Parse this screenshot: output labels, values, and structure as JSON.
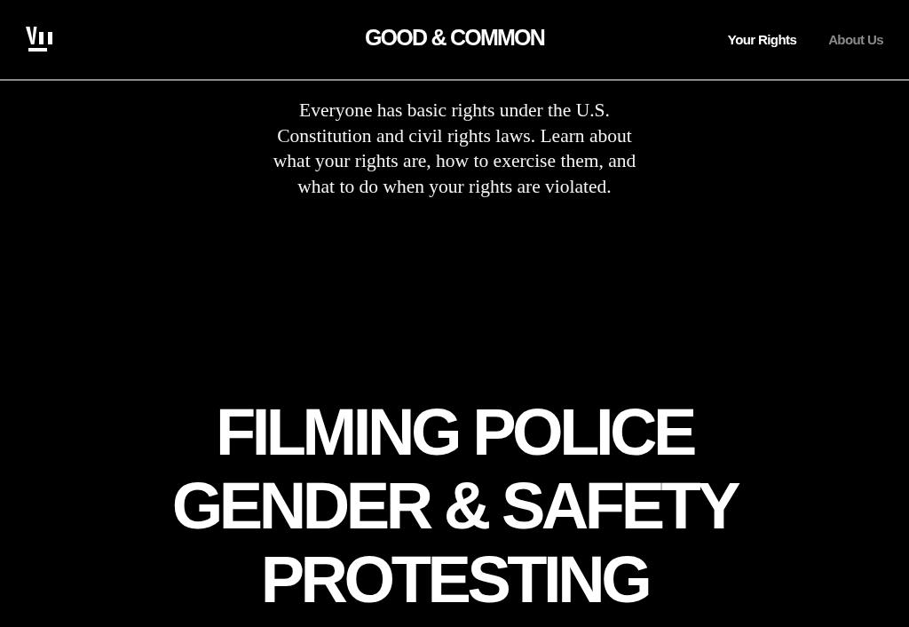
{
  "header": {
    "site_title": "GOOD & COMMON",
    "nav": [
      {
        "label": "Your Rights",
        "selected": true
      },
      {
        "label": "About Us",
        "selected": false
      }
    ]
  },
  "intro": "Everyone has basic rights under the U.S. Constitution and civil rights laws. Learn about what your rights are, how to exercise them, and what to do when your rights are violated.",
  "topics": [
    "FILMING POLICE",
    "GENDER & SAFETY",
    "PROTESTING"
  ]
}
